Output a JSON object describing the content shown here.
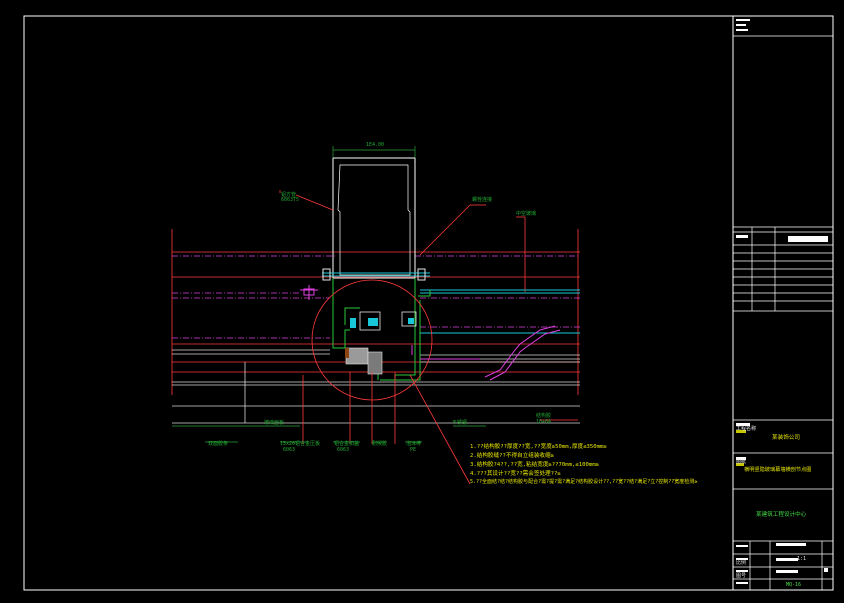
{
  "colors": {
    "background": "#000000",
    "frame": "#ffffff",
    "section_line": "#d8d8d8",
    "grid_line": "#ff3b3b",
    "cyan_line": "#18c8d8",
    "magenta_line": "#e040e0",
    "green_line": "#27c83a",
    "note_text": "#e6e600",
    "dimension_text": "#2aa33a"
  },
  "drawing": {
    "dimension_top": "1E4.00",
    "callouts": {
      "left_tube_a": "铝方管",
      "left_tube_b": "6063T5",
      "right_plate_a": "螺栓连接",
      "right_plate_b": "不锈钢",
      "right_glass": "中空玻璃",
      "right_lower_a": "结构胶",
      "right_lower_b": "10+6A"
    },
    "bottom_labels": [
      {
        "top": "双面胶条",
        "bottom": ""
      },
      {
        "top": "15x20铝合金压板",
        "bottom": "6063"
      },
      {
        "top": "铝合金扣盖",
        "bottom": "6063"
      },
      {
        "top": "耐候胶",
        "bottom": ""
      },
      {
        "top": "泡沫棒",
        "bottom": "PE"
      }
    ],
    "left_dimension_label": "玻璃面板"
  },
  "notes": [
    "1.??结构胶??厚度??宽,??宽度≥50mm,厚度≤350mm≥",
    "2.结构胶缝??不得自立组装收缩≥",
    "3.结构胶?4??,??宽,粘结宽度≥??70mm,≤100mm≥",
    "4.???其设计??宽??需会签处理??≥",
    "5.??全面结?结?结构胶与配合?需?提?需?满足?结构胶设计??,??宽??结?满足?立?控制??宽度检测≥"
  ],
  "title_block": {
    "stamp_lines": [
      "",
      ""
    ],
    "project_label": "工程名称",
    "company_value": "某装饰公司",
    "drawing_label": "图纸",
    "drawing_value": "横明竖隐玻璃幕墙横剖节点图",
    "center_value": "某建筑工程设计中心",
    "scale_label": "比例",
    "scale_value": "1:1",
    "sheet_label": "图号",
    "sheet_value": "MQ-16",
    "page_value": "1"
  }
}
